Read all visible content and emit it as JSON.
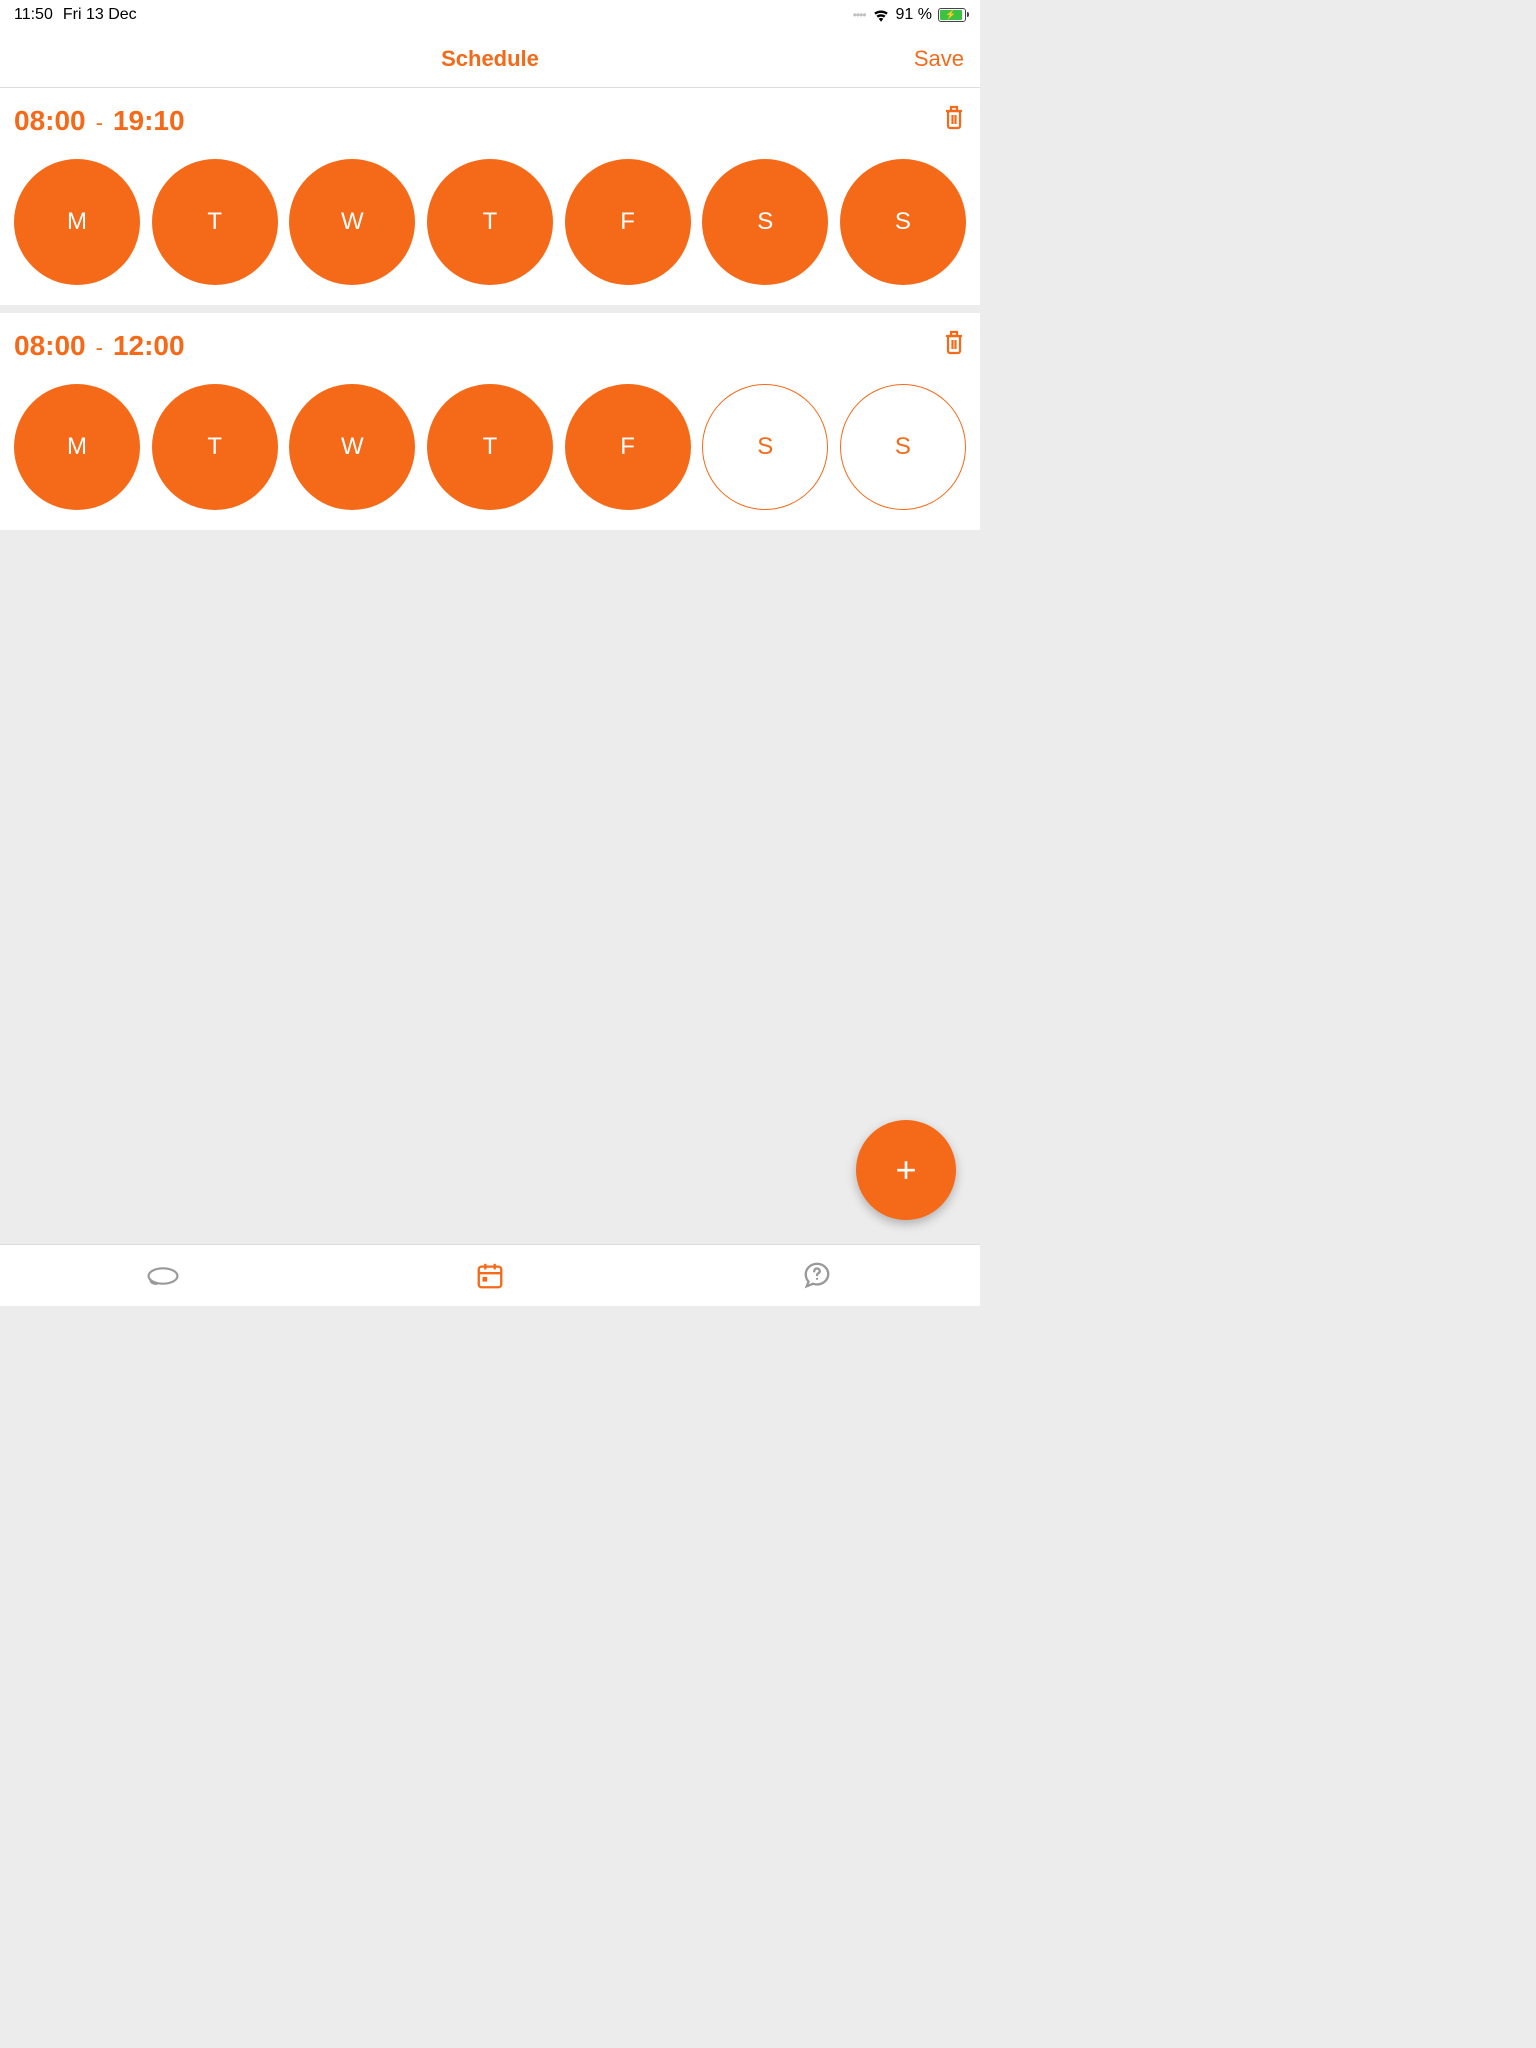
{
  "status": {
    "time": "11:50",
    "date": "Fri 13 Dec",
    "battery_pct": "91 %"
  },
  "nav": {
    "title": "Schedule",
    "save_label": "Save"
  },
  "schedules": [
    {
      "start": "08:00",
      "end": "19:10",
      "days": [
        {
          "label": "M",
          "active": true
        },
        {
          "label": "T",
          "active": true
        },
        {
          "label": "W",
          "active": true
        },
        {
          "label": "T",
          "active": true
        },
        {
          "label": "F",
          "active": true
        },
        {
          "label": "S",
          "active": true
        },
        {
          "label": "S",
          "active": true
        }
      ]
    },
    {
      "start": "08:00",
      "end": "12:00",
      "days": [
        {
          "label": "M",
          "active": true
        },
        {
          "label": "T",
          "active": true
        },
        {
          "label": "W",
          "active": true
        },
        {
          "label": "T",
          "active": true
        },
        {
          "label": "F",
          "active": true
        },
        {
          "label": "S",
          "active": false
        },
        {
          "label": "S",
          "active": false
        }
      ]
    }
  ]
}
